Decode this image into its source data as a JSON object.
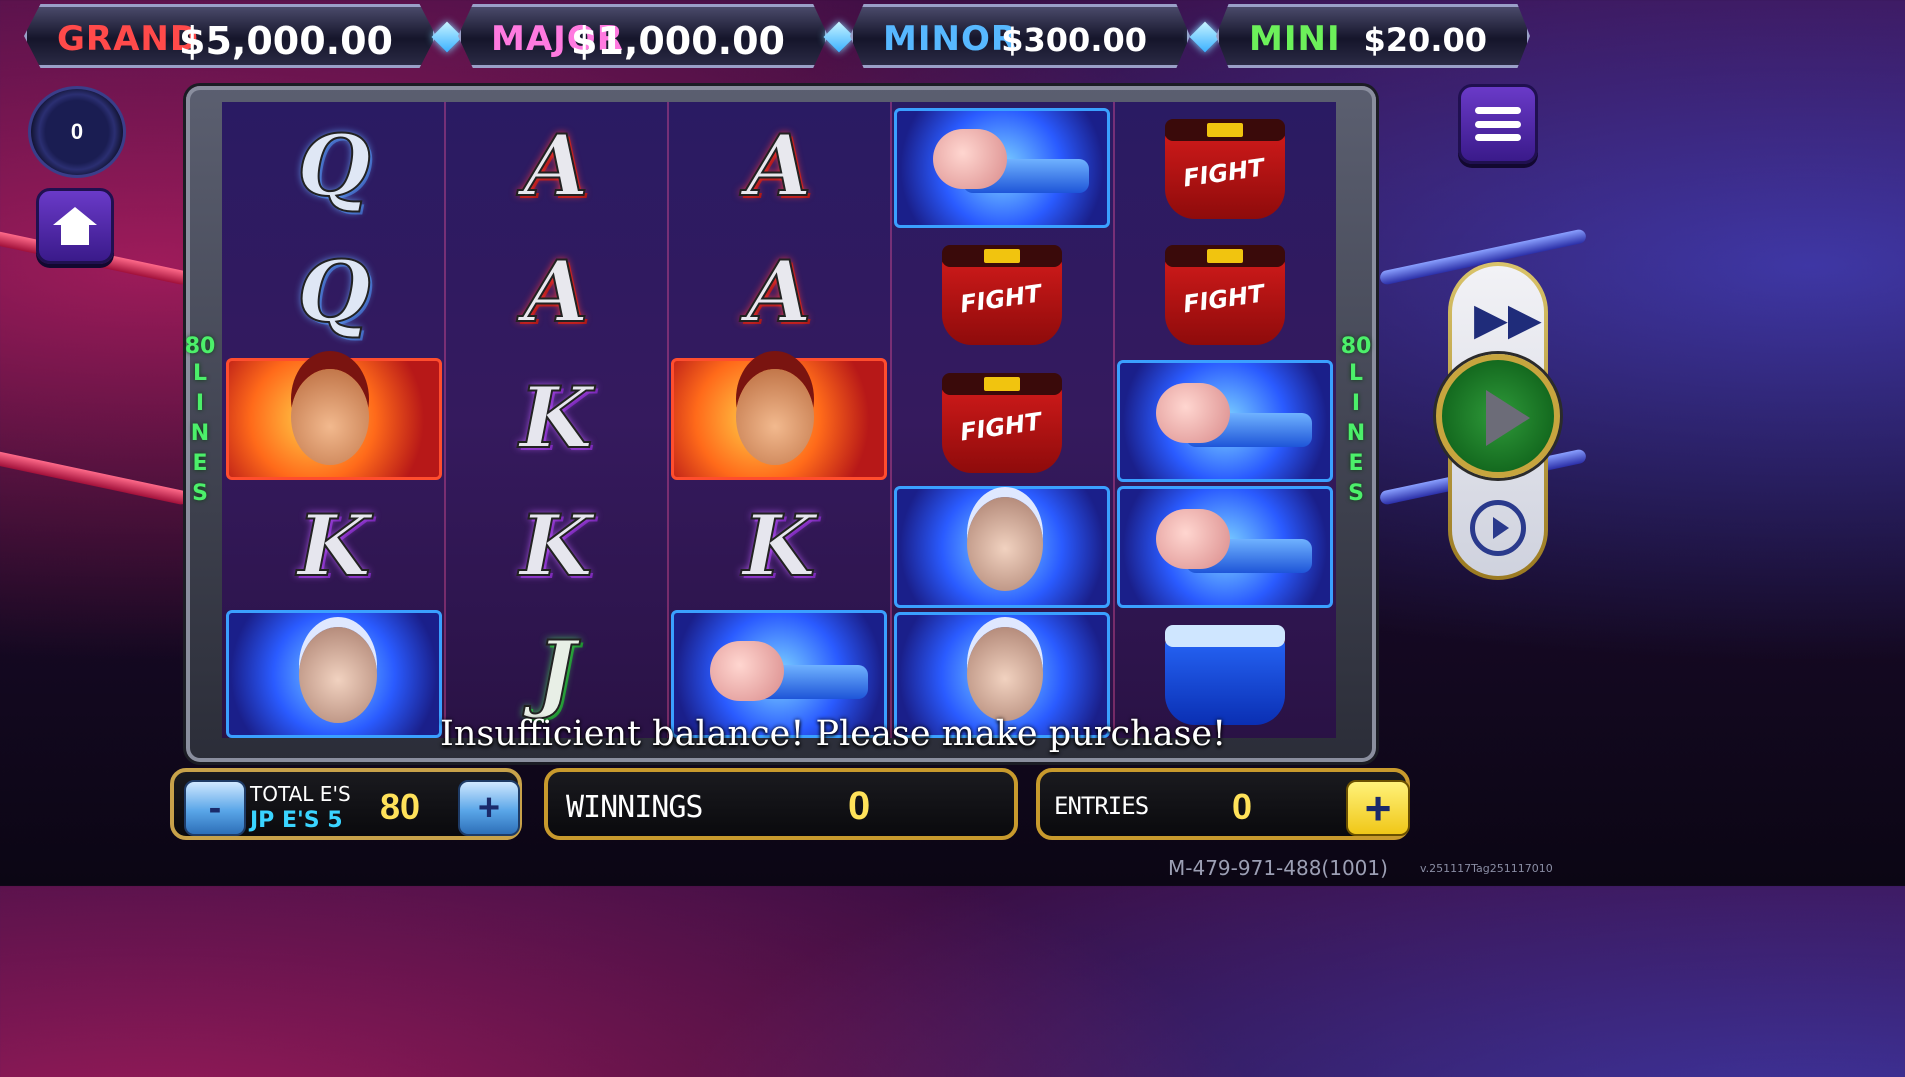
{
  "jackpots": [
    {
      "label": "GRAND",
      "value": "$5,000.00",
      "color": "#ff4a4a"
    },
    {
      "label": "MAJOR",
      "value": "$1,000.00",
      "color": "#ff7ae0"
    },
    {
      "label": "MINOR",
      "value": "$300.00",
      "color": "#57b8ff"
    },
    {
      "label": "MINI",
      "value": "$20.00",
      "color": "#6cf05a"
    }
  ],
  "counter": "0",
  "paylines": {
    "number": "80",
    "word": "LINES"
  },
  "reels": [
    [
      "Q",
      "Q",
      "red-fighter",
      "K",
      "white-haired-fighter"
    ],
    [
      "A",
      "A",
      "K",
      "K",
      "J"
    ],
    [
      "A",
      "A",
      "red-fighter",
      "K",
      "fist"
    ],
    [
      "fist",
      "red-fight-shorts",
      "red-fight-shorts",
      "white-haired-fighter",
      "white-haired-fighter"
    ],
    [
      "red-fight-shorts",
      "red-fight-shorts",
      "fist",
      "fist",
      "blue-shorts"
    ]
  ],
  "shorts_text": "FIGHT",
  "message": "Insufficient balance! Please make purchase!",
  "bet": {
    "minus": "-",
    "plus": "+",
    "total_label": "TOTAL E'S",
    "jp_label": "JP E'S 5",
    "value": "80"
  },
  "winnings": {
    "label": "WINNINGS",
    "value": "0"
  },
  "entries": {
    "label": "ENTRIES",
    "value": "0",
    "add": "+"
  },
  "machine_id": "M-479-971-488(1001)",
  "version": "v.251117Tag251117010"
}
